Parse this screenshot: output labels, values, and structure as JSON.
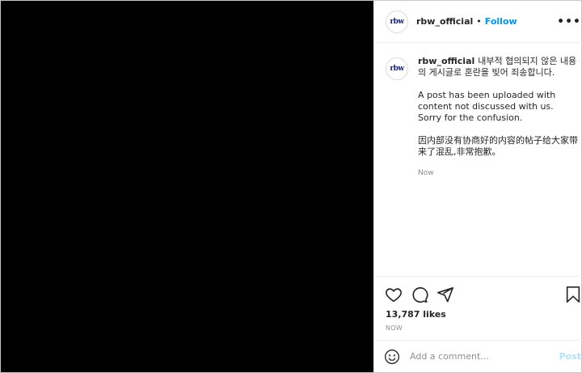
{
  "header": {
    "avatar_text": "rbw",
    "username": "rbw_official",
    "separator": "•",
    "follow_label": "Follow",
    "more_label": "•••"
  },
  "caption": {
    "avatar_text": "rbw",
    "username": "rbw_official",
    "korean": "내부적 협의되지 않은 내용의 게시글로 혼란을 빚어 죄송합니다.",
    "english": "A post has been uploaded with content not discussed with us. Sorry for the confusion.",
    "chinese": "因内部没有协商好的内容的帖子给大家带来了混乱,非常抱歉。",
    "time": "Now"
  },
  "engagement": {
    "likes": "13,787 likes",
    "post_time": "NOW"
  },
  "comment_box": {
    "placeholder": "Add a comment...",
    "post_label": "Post"
  },
  "icons": {
    "like": "heart-icon",
    "comment": "comment-icon",
    "share": "share-icon",
    "save": "bookmark-icon",
    "emoji": "emoji-icon"
  },
  "colors": {
    "media_background": "#000000",
    "follow": "#0095f6",
    "post_disabled": "#b2dffc",
    "muted": "#8e8e8e",
    "brand_logo": "#1a237e"
  }
}
